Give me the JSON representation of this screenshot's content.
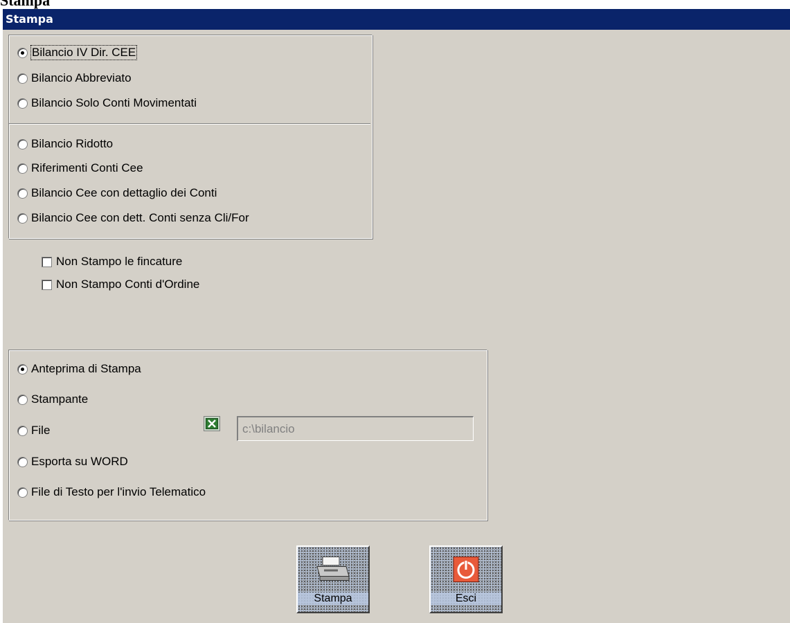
{
  "outer_title": "Stampa",
  "window": {
    "title": "Stampa"
  },
  "report_type": {
    "options": [
      "Bilancio IV Dir. CEE",
      "Bilancio Abbreviato",
      "Bilancio Solo Conti Movimentati",
      "Bilancio Ridotto",
      "Riferimenti Conti Cee",
      "Bilancio Cee con dettaglio dei Conti",
      "Bilancio Cee con dett. Conti senza Cli/For"
    ],
    "selected": "Bilancio IV Dir. CEE"
  },
  "checkboxes": [
    {
      "label": "Non Stampo le fincature",
      "checked": false
    },
    {
      "label": "Non Stampo Conti d'Ordine",
      "checked": false
    }
  ],
  "output": {
    "options": [
      "Anteprima di Stampa",
      "Stampante",
      "File",
      "Esporta su WORD",
      "File di Testo per l'invio Telematico"
    ],
    "selected": "Anteprima di Stampa",
    "file_path": "c:\\bilancio",
    "file_icon": "excel-icon"
  },
  "buttons": {
    "stampa": {
      "label": "Stampa",
      "icon": "printer-icon"
    },
    "esci": {
      "label": "Esci",
      "icon": "power-icon"
    }
  },
  "colors": {
    "titlebar": "#0a246a",
    "dialog_bg": "#d4d0c8",
    "button_face": "#b8c8e0"
  }
}
